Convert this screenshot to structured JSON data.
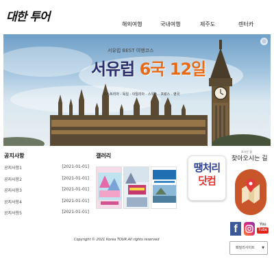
{
  "header": {
    "logo_text": "대한 투어",
    "nav": [
      {
        "label": "해외여행"
      },
      {
        "label": "국내여행"
      },
      {
        "label": "제주도"
      },
      {
        "label": "렌터카"
      }
    ]
  },
  "hero": {
    "subtitle": "서유럽 BEST 여행코스",
    "title_main": "서유럽 ",
    "title_accent": "6국 12일",
    "tagline": "오스트리아 · 독일 · 이탈리아 · 스위스 · 프랑스 · 영국"
  },
  "notice": {
    "title": "공지사항",
    "items": [
      {
        "title": "공지사항1",
        "date": "[2021-01-01]"
      },
      {
        "title": "공지사항2",
        "date": "[2021-01-01]"
      },
      {
        "title": "공지사항3",
        "date": "[2021-01-01]"
      },
      {
        "title": "공지사항4",
        "date": "[2021-01-01]"
      },
      {
        "title": "공지사항5",
        "date": "[2021-01-01]"
      }
    ]
  },
  "gallery": {
    "title": "갤러리"
  },
  "promo": {
    "line1": "땡처리",
    "line2": "닷컴"
  },
  "directions": {
    "small_label": "오시는 길",
    "title": "찾아오시는 길"
  },
  "social": {
    "facebook_glyph": "f",
    "youtube_you": "You",
    "youtube_tube": "Tube"
  },
  "family_site": {
    "label": "패밀리사이트"
  },
  "footer": {
    "copyright": "Copyright © 2021 Korea TOUR All rights reserved"
  },
  "colors": {
    "hero_title_orange": "#e86a16",
    "hero_title_navy": "#2a2f6b",
    "promo_blue": "#2c3e8f",
    "promo_red": "#e5322d",
    "directions_circle": "#c9562a",
    "facebook": "#3b5998",
    "youtube": "#e62117"
  }
}
